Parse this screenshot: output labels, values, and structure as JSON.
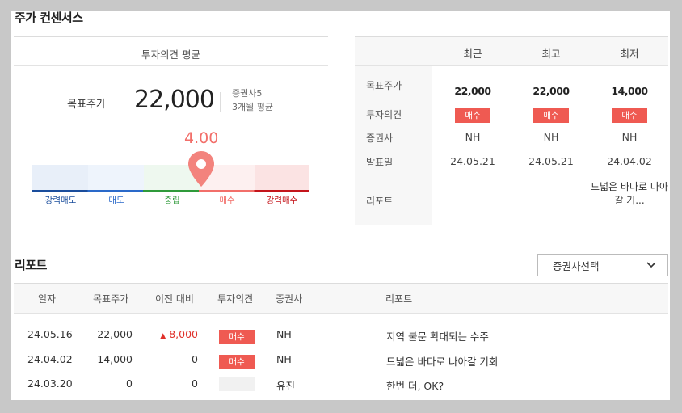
{
  "section_title": "주가 컨센서스",
  "consensus": {
    "average_title": "투자의견 평균",
    "target_label": "목표주가",
    "target_value": "22,000",
    "broker_count": "증권사5",
    "period": "3개월 평균",
    "score": "4.00",
    "score_value": 4.0,
    "scale_labels": [
      "강력매도",
      "매도",
      "중립",
      "매수",
      "강력매수"
    ],
    "scale_colors": [
      "#1a4d9c",
      "#2a69c9",
      "#2f9a3a",
      "#f26f6a",
      "#c4151b"
    ]
  },
  "summary_table": {
    "headers": [
      "최근",
      "최고",
      "최저"
    ],
    "row_labels": {
      "target": "목표주가",
      "opinion": "투자의견",
      "broker": "증권사",
      "date": "발표일",
      "report": "리포트"
    },
    "columns": [
      {
        "target": "22,000",
        "opinion": "매수",
        "broker": "NH",
        "date": "24.05.21",
        "report": ""
      },
      {
        "target": "22,000",
        "opinion": "매수",
        "broker": "NH",
        "date": "24.05.21",
        "report": ""
      },
      {
        "target": "14,000",
        "opinion": "매수",
        "broker": "NH",
        "date": "24.04.02",
        "report": "드넓은 바다로 나아갈 기..."
      }
    ]
  },
  "report_section": {
    "title": "리포트",
    "dropdown_label": "증권사선택",
    "headers": [
      "일자",
      "목표주가",
      "이전 대비",
      "투자의견",
      "증권사",
      "리포트"
    ],
    "rows": [
      {
        "date": "24.05.16",
        "target": "22,000",
        "change": "8,000",
        "change_up": true,
        "opinion": "매수",
        "broker": "NH",
        "title": "지역 불문 확대되는 수주"
      },
      {
        "date": "24.04.02",
        "target": "14,000",
        "change": "0",
        "change_up": false,
        "opinion": "매수",
        "broker": "NH",
        "title": "드넓은 바다로 나아갈 기회"
      },
      {
        "date": "24.03.20",
        "target": "0",
        "change": "0",
        "change_up": false,
        "opinion": "",
        "broker": "유진",
        "title": "한번 더, OK?"
      }
    ]
  }
}
